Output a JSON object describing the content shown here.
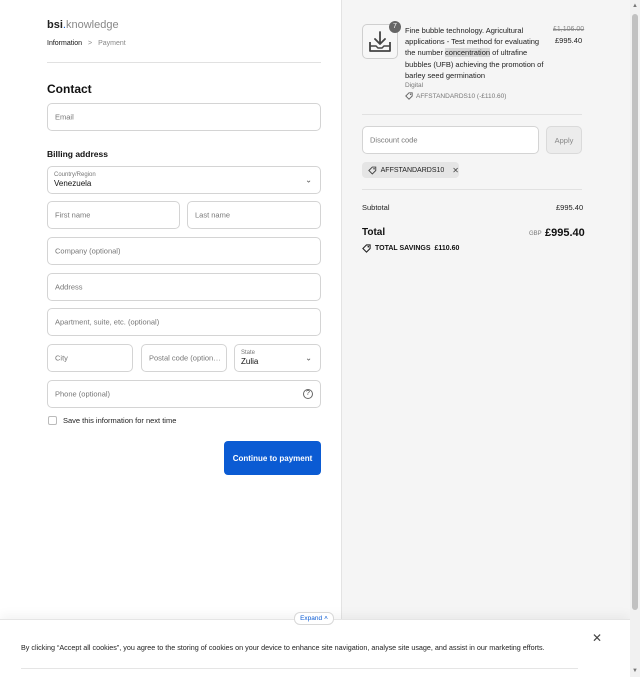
{
  "logo": {
    "brand": "bsi",
    "dot": ".",
    "suffix": "knowledge"
  },
  "breadcrumb": {
    "current": "Information",
    "separator": ">",
    "next": "Payment"
  },
  "contact": {
    "heading": "Contact",
    "email_placeholder": "Email"
  },
  "billing": {
    "heading": "Billing address",
    "country_label": "Country/Region",
    "country_value": "Venezuela",
    "first_name": "First name",
    "last_name": "Last name",
    "company": "Company (optional)",
    "address": "Address",
    "apartment": "Apartment, suite, etc. (optional)",
    "city": "City",
    "postal": "Postal code (option…",
    "state_label": "State",
    "state_value": "Zulia",
    "phone": "Phone (optional)",
    "help_glyph": "?",
    "save_info": "Save this information for next time"
  },
  "continue_button": "Continue to payment",
  "order": {
    "quantity": "7",
    "title_pre": "Fine bubble technology. Agricultural applications - Test method for evaluating the number ",
    "title_hl": "concentration",
    "title_post": " of ultrafine bubbles (UFB) achieving the promotion of barley seed germination",
    "type": "Digital",
    "discount_applied": "AFFSTANDARDS10 (-£110.60)",
    "old_price": "£1,106.00",
    "new_price": "£995.40"
  },
  "discount": {
    "placeholder": "Discount code",
    "apply": "Apply",
    "tag": "AFFSTANDARDS10",
    "remove": "✕"
  },
  "summary": {
    "subtotal_label": "Subtotal",
    "subtotal_value": "£995.40",
    "total_label": "Total",
    "currency": "GBP",
    "total_value": "£995.40",
    "savings_label": "TOTAL SAVINGS",
    "savings_value": "£110.60"
  },
  "cookie": {
    "expand": "Expand",
    "text": "By clicking “Accept all cookies”, you agree to the storing of cookies on your device to enhance site navigation, analyse site usage, and assist in our marketing efforts.",
    "close": "✕"
  },
  "colors": {
    "accent": "#0b5bd3",
    "panel": "#f5f5f5",
    "border": "#d4d4d4"
  }
}
